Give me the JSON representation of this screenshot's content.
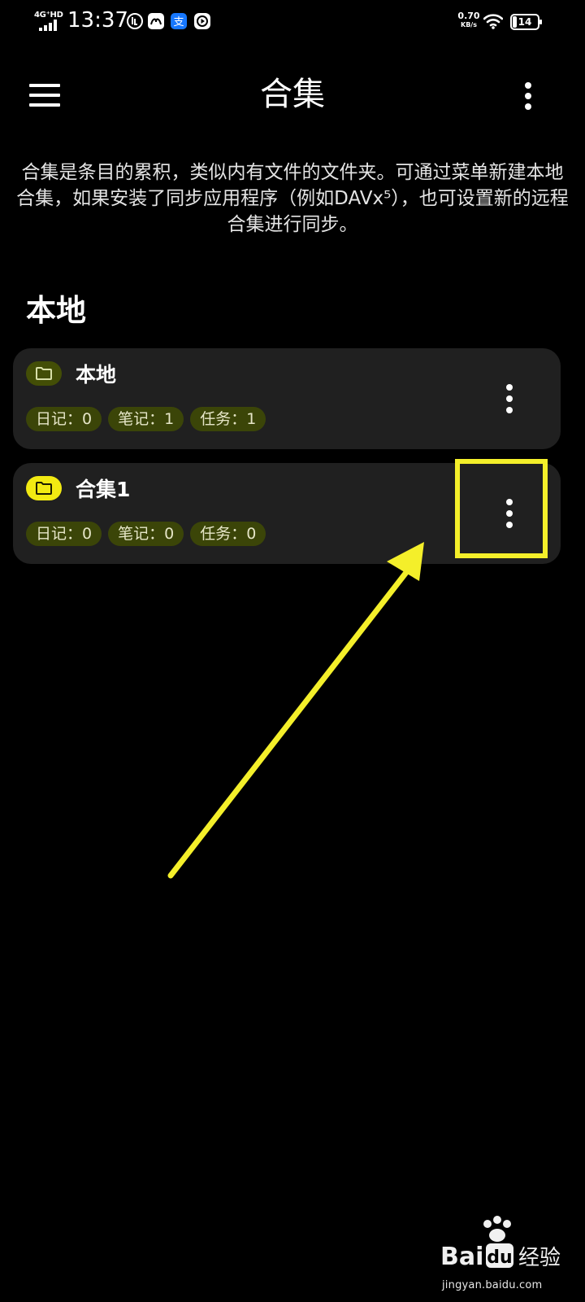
{
  "status_bar": {
    "network": "4G⁺HD",
    "time": "13:37",
    "data_rate": "0.70",
    "data_rate_unit": "KB/s",
    "battery": "14",
    "icons": [
      "power-saving-icon",
      "meitu-app-icon",
      "alipay-icon",
      "video-app-icon",
      "wifi-icon",
      "battery-icon"
    ]
  },
  "header": {
    "title": "合集",
    "menu_icon": "hamburger-menu-icon",
    "overflow_icon": "more-vert-icon"
  },
  "intro_text": "合集是条目的累积，类似内有文件的文件夹。可通过菜单新建本地合集，如果安装了同步应用程序（例如DAVx⁵），也可设置新的远程合集进行同步。",
  "section": {
    "heading": "本地"
  },
  "collections": [
    {
      "name": "本地",
      "folder_color": "#434e06",
      "counts": [
        "日记：0",
        "笔记：1",
        "任务：1"
      ]
    },
    {
      "name": "合集1",
      "folder_color": "#f2ea12",
      "counts": [
        "日记：0",
        "笔记：0",
        "任务：0"
      ]
    }
  ],
  "annotation": {
    "color": "#f4ef2a",
    "target": "collection-2-more-button"
  },
  "watermark": {
    "brand": "Baidu经验",
    "url": "jingyan.baidu.com"
  },
  "colors": {
    "background": "#000000",
    "card": "#202020",
    "badge": "#3b4508",
    "accent_yellow": "#f2ea12"
  }
}
